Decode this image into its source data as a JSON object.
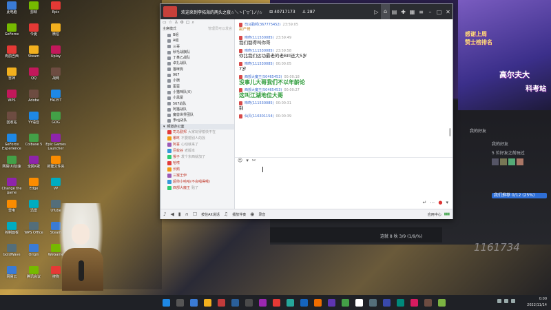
{
  "chat_window": {
    "title": "欢迎来到李拓海的两头之夜☆＼ヽ(ˉ▽ˉ)ノ/☆",
    "viewers": "40717173",
    "users": "287"
  },
  "left_pane": {
    "mode_label": "主席模式",
    "search_placeholder": "管理员可以发言",
    "tree": [
      "B组",
      "A组",
      "三哥",
      "秋毛战旗队",
      "丁某乙战队",
      "卓扎战队",
      "猫咪狗",
      "967",
      "小旗",
      "歪歪",
      "小猫咪队(0)",
      "小黑屋",
      "567战队",
      "阿猫战队",
      "魔兽世界团队",
      "李cjj战队"
    ],
    "section_header": "频道办公室",
    "members": [
      {
        "name": "司马勤邦",
        "tail": "大家玩得愉快不在"
      },
      {
        "name": "哪咚",
        "tail": "不要帮别人的找"
      },
      {
        "name": "阿喜",
        "tail": "心动就来了"
      },
      {
        "name": "巨蚊谷",
        "tail": "老版本"
      },
      {
        "name": "猴子",
        "tail": "发个东西就加了"
      },
      {
        "name": "哈嗦",
        "tail": ""
      },
      {
        "name": "长鹅",
        "tail": ""
      },
      {
        "name": "三猴王伊",
        "tail": ""
      },
      {
        "name": "超帅小哈哈(不会唱得哦)",
        "tail": ""
      },
      {
        "name": "西部大魔王",
        "tail": "贴了"
      }
    ]
  },
  "messages": [
    {
      "user": "司马勤邦(367775452)",
      "time": "23:59:05",
      "text": "副产哥",
      "style": "gray"
    },
    {
      "user": "啼咚(111530085)",
      "time": "23:59:49",
      "text": "我们都得叫你哥",
      "style": "normal"
    },
    {
      "user": "啼咚(111530085)",
      "time": "23:59:58",
      "text": "你比我们达功最老的老BIll还大5岁",
      "style": "normal"
    },
    {
      "user": "啼咚(111530085)",
      "time": "00:00:05",
      "text": "7岁",
      "style": "normal"
    },
    {
      "user": "西部大魔王(50465453)",
      "time": "00:00:18",
      "text": "没事儿大哥我们不以年龄论",
      "style": "green"
    },
    {
      "user": "西部大魔王(50465453)",
      "time": "00:00:27",
      "text": "这叫江湖地位大哥",
      "style": "green"
    },
    {
      "user": "啼咚(111530085)",
      "time": "00:00:31",
      "text": "别",
      "style": "normal"
    },
    {
      "user": "仙贝(116301154)",
      "time": "00:00:39",
      "text": "",
      "style": "normal"
    }
  ],
  "bottom_bar": {
    "hold_to_talk": "按住Alt说话",
    "broadcast": "播放伴奏",
    "record": "录音",
    "app_label": "应用中心"
  },
  "game_panel": {
    "banner_line1": "感谢上周",
    "banner_line2": "赞士榜排名",
    "banner_big": "高尔夫大",
    "banner_sub": "科考站",
    "friends_online": "我的好友",
    "friend_line1": "5 位好友之前玩过",
    "friend_bar": "我们推荐 0/12 (25%)",
    "dl_text": "这就 8 秋 3/9 (1/9/%)",
    "number": "1161734"
  },
  "taskbar": {
    "time": "0:00",
    "date": "2022/11/14"
  },
  "desktop_icons": [
    "此电脑",
    "GeForce",
    "肉鸽巴西",
    "雷神",
    "WPS",
    "回收站",
    "GeForce Experience",
    "网易UU加速",
    "Change the game",
    "雷电",
    "控制面板",
    "GoldWave",
    "网易云",
    "剪映",
    "今夏",
    "Steam",
    "QQ",
    "Adobe",
    "YY语音",
    "Colbase 5",
    "全民K歌",
    "Edge",
    "迅雷",
    "WPS Office",
    "Origin",
    "腾讯会议",
    "Epic",
    "微信",
    "Uplay",
    "战网",
    "FACEIT",
    "GOG",
    "Epic Games Launcher",
    "新建文件夹",
    "VP",
    "UTube",
    "Steam",
    "WeGame",
    "搜狗"
  ]
}
